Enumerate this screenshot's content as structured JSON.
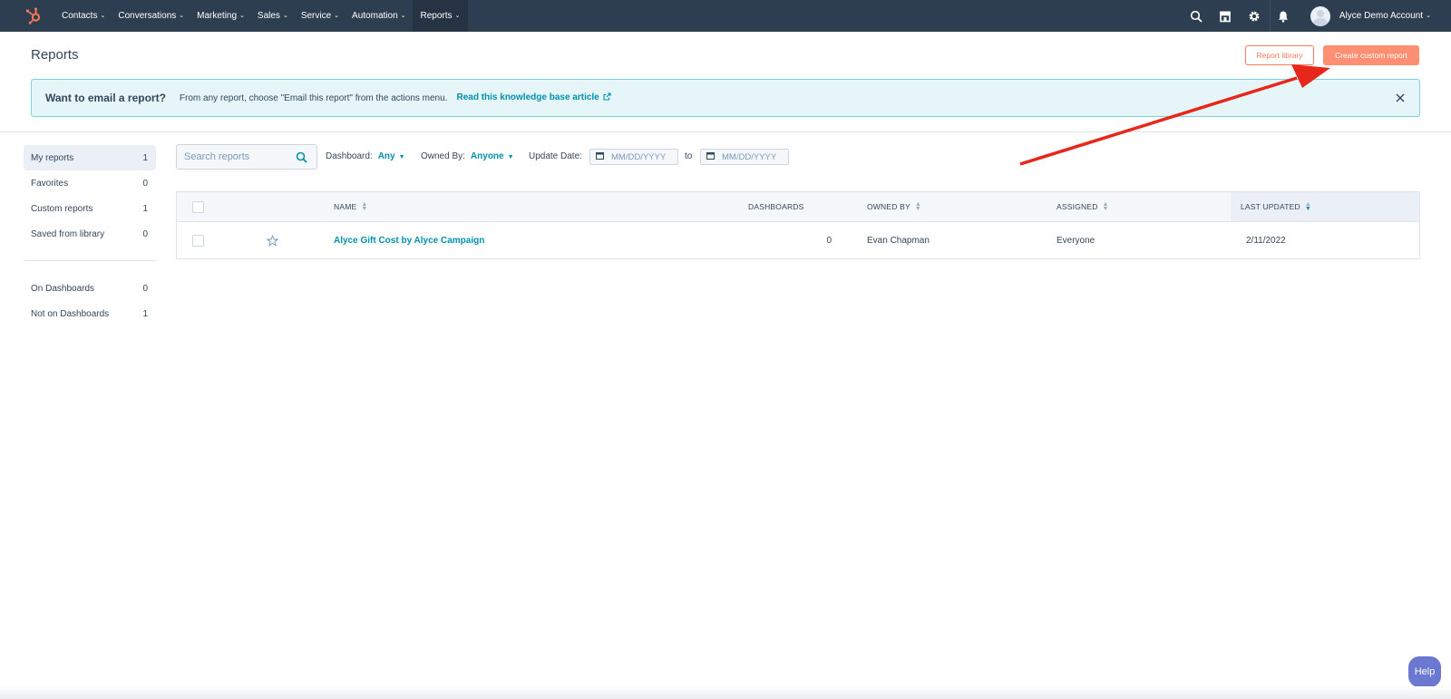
{
  "nav": {
    "items": [
      {
        "label": "Contacts"
      },
      {
        "label": "Conversations"
      },
      {
        "label": "Marketing"
      },
      {
        "label": "Sales"
      },
      {
        "label": "Service"
      },
      {
        "label": "Automation"
      },
      {
        "label": "Reports",
        "active": true
      }
    ],
    "icons": [
      "search-icon",
      "marketplace-icon",
      "settings-icon",
      "notifications-icon"
    ],
    "account_name": "Alyce Demo Account"
  },
  "header": {
    "title": "Reports",
    "secondary_button": "Report library",
    "primary_button": "Create custom report"
  },
  "banner": {
    "title": "Want to email a report?",
    "text": "From any report, choose \"Email this report\" from the actions menu.",
    "link": "Read this knowledge base article"
  },
  "sidebar": {
    "groups": [
      [
        {
          "label": "My reports",
          "count": "1",
          "active": true
        },
        {
          "label": "Favorites",
          "count": "0"
        },
        {
          "label": "Custom reports",
          "count": "1"
        },
        {
          "label": "Saved from library",
          "count": "0"
        }
      ],
      [
        {
          "label": "On Dashboards",
          "count": "0"
        },
        {
          "label": "Not on Dashboards",
          "count": "1"
        }
      ]
    ]
  },
  "filters": {
    "search_placeholder": "Search reports",
    "dashboard_label": "Dashboard:",
    "dashboard_value": "Any",
    "owned_label": "Owned By:",
    "owned_value": "Anyone",
    "date_label": "Update Date:",
    "date_from_placeholder": "MM/DD/YYYY",
    "to_label": "to",
    "date_to_placeholder": "MM/DD/YYYY"
  },
  "table": {
    "columns": [
      "NAME",
      "DASHBOARDS",
      "OWNED BY",
      "ASSIGNED",
      "LAST UPDATED"
    ],
    "rows": [
      {
        "name": "Alyce Gift Cost by Alyce Campaign",
        "dashboards": "0",
        "owned_by": "Evan Chapman",
        "assigned": "Everyone",
        "last_updated": "2/11/2022"
      }
    ]
  },
  "help_label": "Help",
  "colors": {
    "nav_bg": "#2d3e50",
    "accent": "#ff7a59",
    "link": "#0091ae",
    "banner_bg": "#e5f5f8",
    "annotation_arrow": "#e8271b"
  }
}
